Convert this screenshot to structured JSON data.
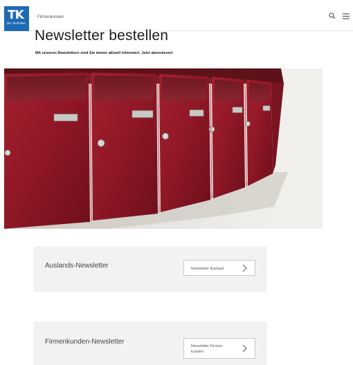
{
  "header": {
    "logo_text": "TK",
    "logo_subtext": "Die Techniker",
    "nav_link": "Firmenkunden",
    "search_icon": "search-icon",
    "menu_icon": "hamburger-menu-icon"
  },
  "page": {
    "title": "Newsletter bestellen",
    "subtitle": "Mit unseren Newslettern sind Sie immer aktuell informiert. Jetzt abonnieren!"
  },
  "hero": {
    "image": "photo of red metal mailboxes on a wall"
  },
  "teasers": [
    {
      "title": "Auslands-Newsletter",
      "button_label": "Newsletter Ausland"
    },
    {
      "title": "Firmenkunden-Newsletter",
      "button_label": "Newsletter Firmen-kunden"
    }
  ],
  "colors": {
    "brand": "#1e6ab3",
    "mailbox_red": "#9b1c2c",
    "teaser_bg": "#f2f2f2"
  }
}
